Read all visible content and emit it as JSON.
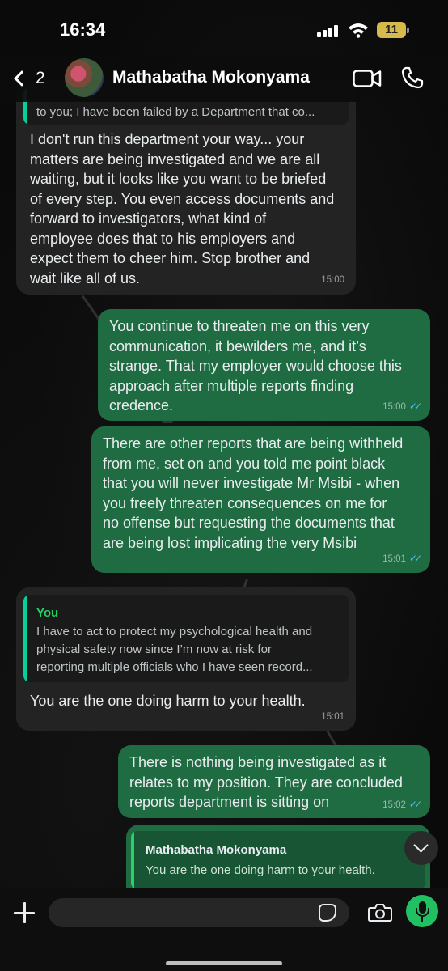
{
  "status_bar": {
    "time": "16:34",
    "battery": "11"
  },
  "header": {
    "back_count": "2",
    "contact_name": "Mathabatha Mokonyama"
  },
  "messages": [
    {
      "direction": "in",
      "quote_text": "to you; I have been failed by a Department that co...",
      "text": "I don't run this department your way... your\nmatters are being investigated and we are all\nwaiting, but it looks like you want to be briefed\nof every step. You even access documents and\nforward to investigators, what kind of\nemployee does that to his employers and\nexpect them to cheer him. Stop brother and\nwait like all of us.",
      "time": "15:00"
    },
    {
      "direction": "out",
      "text": "You continue to threaten me on this very\ncommunication, it bewilders me, and it’s\nstrange. That my employer would choose this\napproach after multiple reports finding\ncredence.",
      "time": "15:00"
    },
    {
      "direction": "out",
      "text": "There are other reports that are being withheld\nfrom me, set on and you told me point black\nthat you will never investigate Mr Msibi - when\nyou freely threaten consequences on me for\nno offense but requesting the documents that\nare being lost implicating the very Msibi",
      "time": "15:01"
    },
    {
      "direction": "in",
      "quote_name": "You",
      "quote_text": "I have to act to protect my psychological health and\nphysical safety now since I’m now at risk for\nreporting multiple officials who I have seen record...",
      "text": "You are the one doing harm to your health.",
      "time": "15:01"
    },
    {
      "direction": "out",
      "text": "There is nothing being investigated as it\nrelates to my position. They are concluded\nreports department is sitting on",
      "time": "15:02"
    },
    {
      "direction": "out",
      "quote_name": "Mathabatha Mokonyama",
      "quote_text": "You are the one doing harm to your health."
    }
  ],
  "input": {
    "placeholder": ""
  },
  "colors": {
    "outgoing": "#1f6b42",
    "incoming": "#232323",
    "accent": "#25d366",
    "read_ticks": "#53bdeb"
  }
}
